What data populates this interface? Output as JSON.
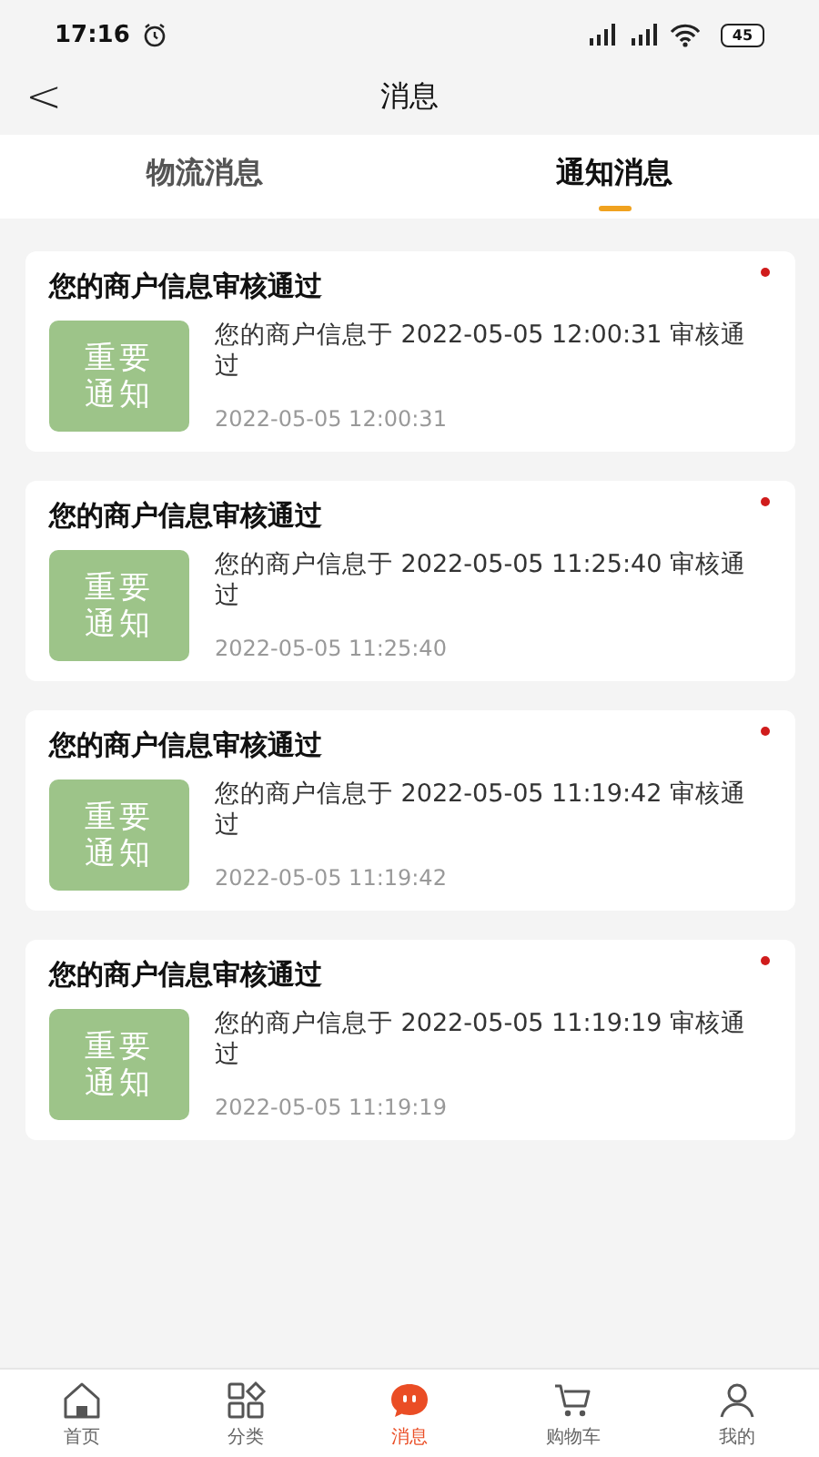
{
  "status_bar": {
    "time": "17:16",
    "battery": "45"
  },
  "header": {
    "back": "<",
    "title": "消息"
  },
  "tabs": [
    {
      "label": "物流消息",
      "selected": false
    },
    {
      "label": "通知消息",
      "selected": true
    }
  ],
  "messages": [
    {
      "title": "您的商户信息审核通过",
      "badge": "重要通知",
      "body": "您的商户信息于 2022-05-05 12:00:31 审核通过",
      "time": "2022-05-05 12:00:31",
      "unread": true
    },
    {
      "title": "您的商户信息审核通过",
      "badge": "重要通知",
      "body": "您的商户信息于 2022-05-05 11:25:40 审核通过",
      "time": "2022-05-05 11:25:40",
      "unread": true
    },
    {
      "title": "您的商户信息审核通过",
      "badge": "重要通知",
      "body": "您的商户信息于 2022-05-05 11:19:42 审核通过",
      "time": "2022-05-05 11:19:42",
      "unread": true
    },
    {
      "title": "您的商户信息审核通过",
      "badge": "重要通知",
      "body": "您的商户信息于 2022-05-05 11:19:19 审核通过",
      "time": "2022-05-05 11:19:19",
      "unread": true
    }
  ],
  "bottom_nav": [
    {
      "kind": "home",
      "label": "首页",
      "selected": false
    },
    {
      "kind": "category",
      "label": "分类",
      "selected": false
    },
    {
      "kind": "message",
      "label": "消息",
      "selected": true
    },
    {
      "kind": "cart",
      "label": "购物车",
      "selected": false
    },
    {
      "kind": "profile",
      "label": "我的",
      "selected": false
    }
  ]
}
